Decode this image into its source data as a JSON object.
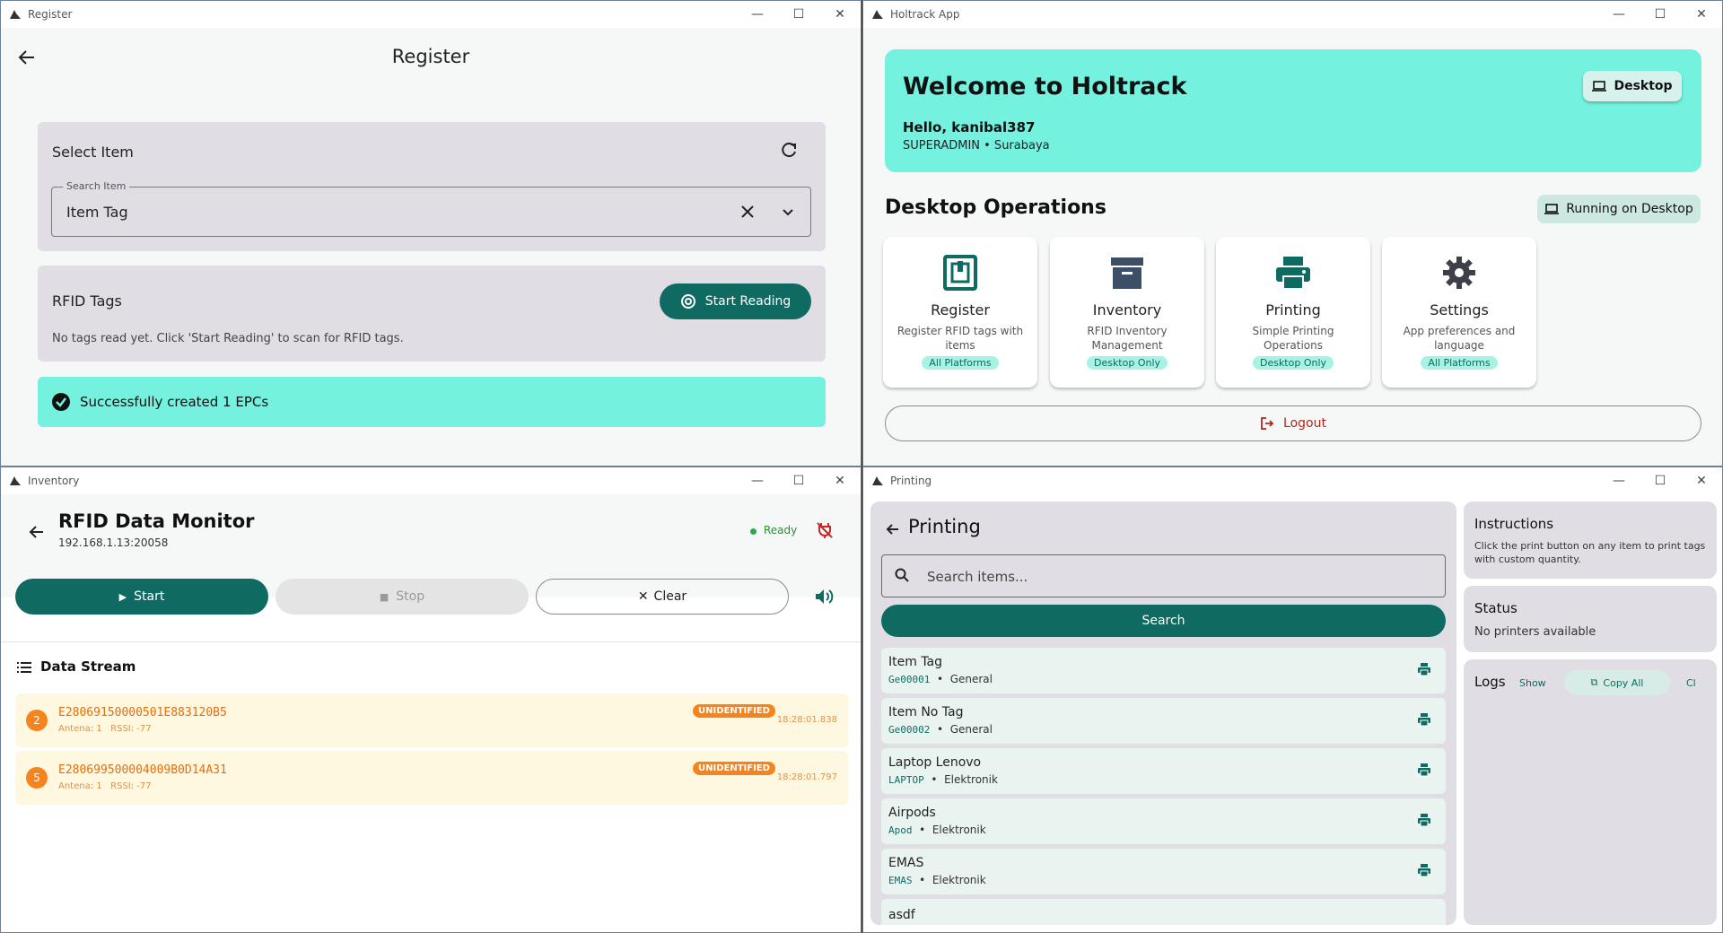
{
  "register": {
    "window_title": "Register",
    "title": "Register",
    "select_item": {
      "heading": "Select Item",
      "field_label": "Search Item",
      "field_value": "Item Tag"
    },
    "rfid": {
      "heading": "RFID Tags",
      "button": "Start Reading",
      "empty_text": "No tags read yet. Click 'Start Reading' to scan for RFID tags."
    },
    "success_text": "Successfully created 1 EPCs"
  },
  "holtrack": {
    "window_title": "Holtrack App",
    "welcome": "Welcome to Holtrack",
    "hello": "Hello, kanibal387",
    "role_line": "SUPERADMIN • Surabaya",
    "desktop_chip": "Desktop",
    "section_title": "Desktop Operations",
    "running_chip": "Running on Desktop",
    "operations": [
      {
        "title": "Register",
        "desc": "Register RFID tags with items",
        "badge": "All Platforms",
        "icon": "register-icon"
      },
      {
        "title": "Inventory",
        "desc": "RFID Inventory Management",
        "badge": "Desktop Only",
        "icon": "archive-icon"
      },
      {
        "title": "Printing",
        "desc": "Simple Printing Operations",
        "badge": "Desktop Only",
        "icon": "printer-icon"
      },
      {
        "title": "Settings",
        "desc": "App preferences and language",
        "badge": "All Platforms",
        "icon": "gear-icon"
      }
    ],
    "logout": "Logout"
  },
  "inventory": {
    "window_title": "Inventory",
    "title": "RFID Data Monitor",
    "address": "192.168.1.13:20058",
    "status": "Ready",
    "start": "Start",
    "stop": "Stop",
    "clear": "Clear",
    "stream_title": "Data Stream",
    "rows": [
      {
        "count": "2",
        "epc": "E28069150000501E883120B5",
        "meta": "Antena: 1   RSSI: -77",
        "badge": "UNIDENTIFIED",
        "time": "18:28:01.838"
      },
      {
        "count": "5",
        "epc": "E280699500004009B0D14A31",
        "meta": "Antena: 1   RSSI: -77",
        "badge": "UNIDENTIFIED",
        "time": "18:28:01.797"
      }
    ]
  },
  "printing": {
    "window_title": "Printing",
    "title": "Printing",
    "search_placeholder": "Search items...",
    "search_button": "Search",
    "items": [
      {
        "name": "Item Tag",
        "code": "Ge00001",
        "category": "General"
      },
      {
        "name": "Item No Tag",
        "code": "Ge00002",
        "category": "General"
      },
      {
        "name": "Laptop Lenovo",
        "code": "LAPTOP",
        "category": "Elektronik"
      },
      {
        "name": "Airpods",
        "code": "Apod",
        "category": "Elektronik"
      },
      {
        "name": "EMAS",
        "code": "EMAS",
        "category": "Elektronik"
      },
      {
        "name": "asdf",
        "code": "",
        "category": ""
      }
    ],
    "instructions_title": "Instructions",
    "instructions_text": "Click the print button on any item to print tags with custom quantity.",
    "status_title": "Status",
    "status_text": "No printers available",
    "logs_title": "Logs",
    "logs_show": "Show",
    "logs_copy": "Copy All",
    "logs_clear": "Cl"
  }
}
